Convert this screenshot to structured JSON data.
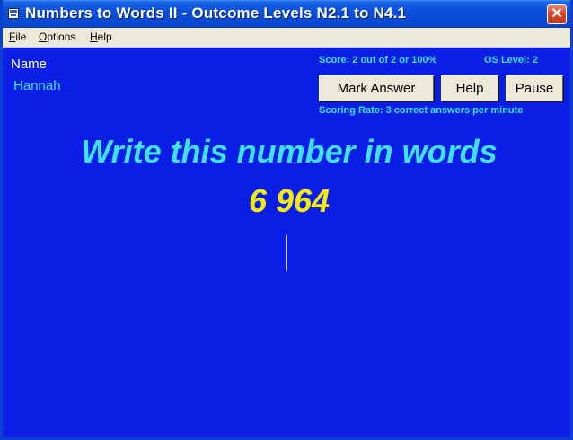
{
  "window": {
    "title": "Numbers to Words II - Outcome Levels N2.1 to N4.1",
    "close_symbol": "✕",
    "app_icon": "app-icon"
  },
  "menu": {
    "file": "File",
    "options": "Options",
    "help": "Help"
  },
  "student": {
    "name_label": "Name",
    "name_value": "Hannah"
  },
  "status": {
    "score": "Score: 2 out of 2 or 100%",
    "os_level": "OS Level: 2",
    "scoring_rate": "Scoring Rate: 3 correct answers per minute"
  },
  "buttons": {
    "mark_answer": "Mark Answer",
    "help": "Help",
    "pause": "Pause"
  },
  "question": {
    "prompt": "Write this number in words",
    "number": "6 964"
  },
  "answer": {
    "value": ""
  },
  "colors": {
    "background": "#0b1ee6",
    "cyan_text": "#3de2ee",
    "number_yellow": "#f2ea10"
  }
}
